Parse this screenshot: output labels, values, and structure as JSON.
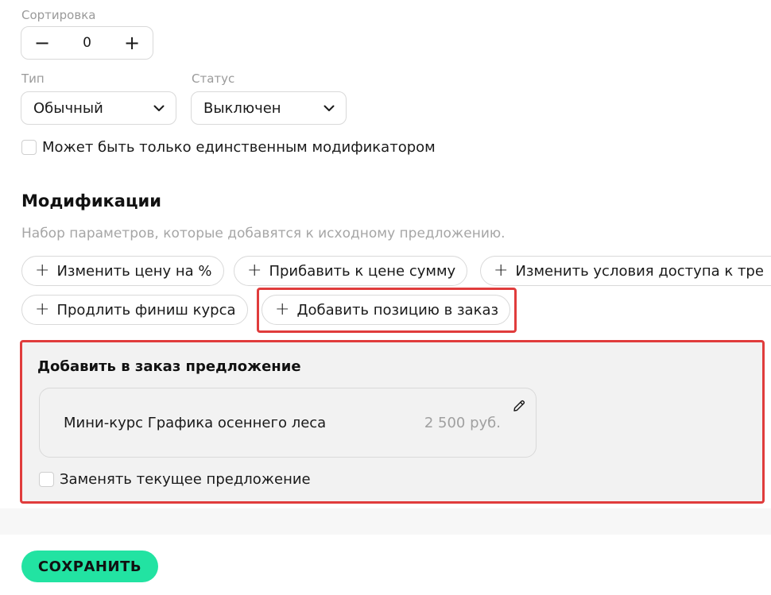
{
  "sorting": {
    "label": "Сортировка",
    "minus": "−",
    "value": "0",
    "plus": "+"
  },
  "type_field": {
    "label": "Тип",
    "value": "Обычный"
  },
  "status_field": {
    "label": "Статус",
    "value": "Выключен"
  },
  "single_modifier": {
    "label": "Может быть только единственным модификатором",
    "checked": false
  },
  "modifications": {
    "title": "Модификации",
    "subtitle": "Набор параметров, которые добавятся к исходному предложению.",
    "chips": [
      "Изменить цену на %",
      "Прибавить к цене сумму",
      "Изменить условия доступа к тре",
      "Продлить финиш курса",
      "Добавить позицию в заказ"
    ],
    "plus_glyph": "+"
  },
  "add_offer_panel": {
    "title": "Добавить в заказ предложение",
    "offer": {
      "name": "Мини-курс Графика осеннего леса",
      "price": "2 500 руб."
    },
    "replace_current": {
      "label": "Заменять текущее предложение",
      "checked": false
    }
  },
  "footer": {
    "save_label": "СОХРАНИТЬ"
  },
  "colors": {
    "accent": "#22e3a2",
    "highlight": "#e03c3c"
  },
  "icons": [
    "chevron-down-icon",
    "pencil-icon",
    "plus-icon"
  ]
}
